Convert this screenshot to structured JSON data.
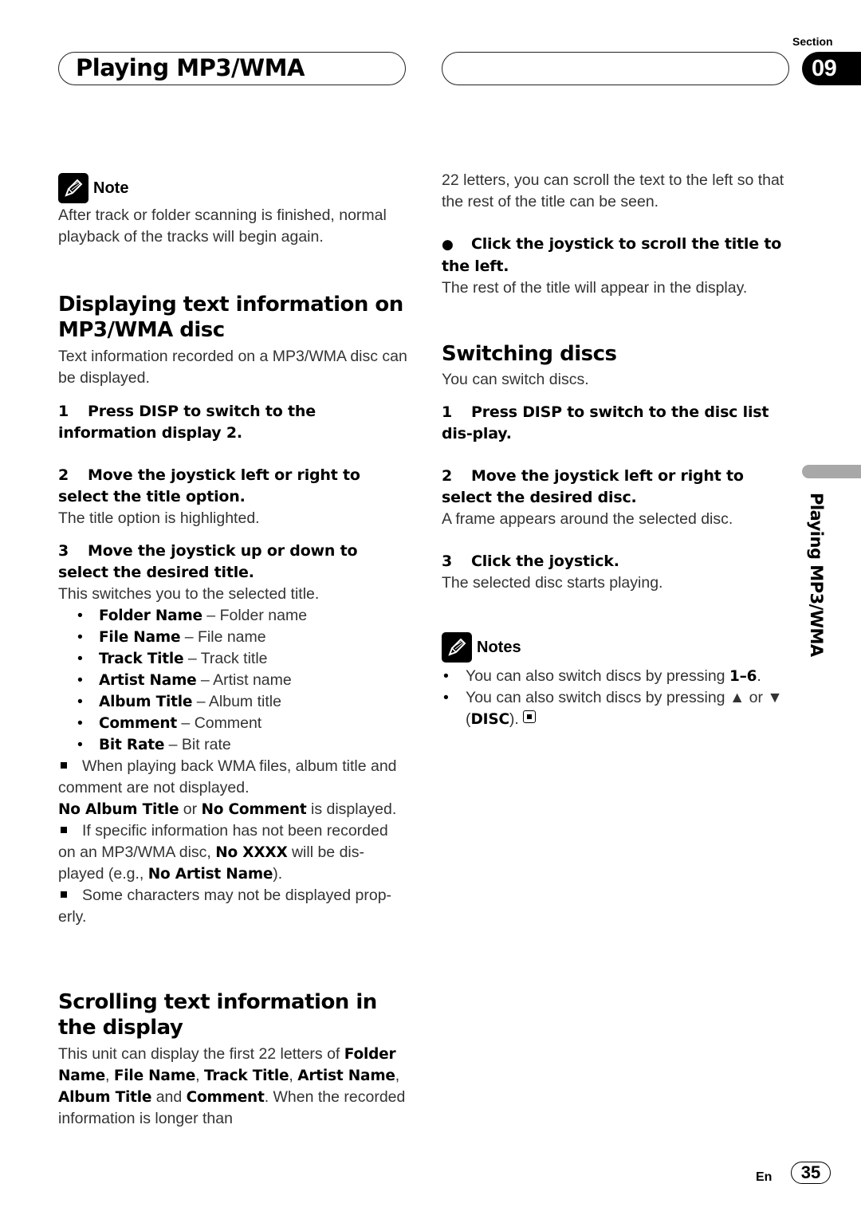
{
  "header": {
    "title": "Playing MP3/WMA",
    "section_label": "Section",
    "section_number": "09"
  },
  "side_tab": {
    "label": "Playing MP3/WMA"
  },
  "left": {
    "note": {
      "title": "Note",
      "icon": "pencil-icon",
      "text": "After track or folder scanning is finished, normal playback of the tracks will begin again."
    },
    "displaying": {
      "heading": "Displaying text information on MP3/WMA disc",
      "intro": "Text information recorded on a MP3/WMA disc can be displayed.",
      "steps": [
        {
          "num": "1",
          "text": "Press DISP to switch to the information display 2.",
          "desc": ""
        },
        {
          "num": "2",
          "text": "Move the joystick left or right to select the title option.",
          "desc": "The title option is highlighted."
        },
        {
          "num": "3",
          "text": "Move the joystick up or down to select the desired title.",
          "desc": "This switches you to the selected title."
        }
      ],
      "options": [
        {
          "bold": "Folder Name",
          "desc": " – Folder name"
        },
        {
          "bold": "File Name",
          "desc": " – File name"
        },
        {
          "bold": "Track Title",
          "desc": " – Track title"
        },
        {
          "bold": "Artist Name",
          "desc": " – Artist name"
        },
        {
          "bold": "Album Title",
          "desc": " – Album title"
        },
        {
          "bold": "Comment",
          "desc": " – Comment"
        },
        {
          "bold": "Bit Rate",
          "desc": " – Bit rate"
        }
      ],
      "remarks": {
        "r1": "When playing back WMA files, album title and comment are not displayed.",
        "r1b_bold1": "No Album Title",
        "r1b_mid": " or ",
        "r1b_bold2": "No Comment",
        "r1b_end": " is displayed.",
        "r2_start": "If specific information has not been recorded on an MP3/WMA disc, ",
        "r2_bold1": "No XXXX",
        "r2_mid": " will be dis-played (e.g., ",
        "r2_bold2": "No Artist Name",
        "r2_end": ").",
        "r3": "Some characters may not be displayed prop-erly."
      }
    },
    "scrolling": {
      "heading": "Scrolling text information in the display",
      "p_start": "This unit can display the first 22 letters of ",
      "b1": "Folder Name",
      "s1": ", ",
      "b2": "File Name",
      "s2": ", ",
      "b3": "Track Title",
      "s3": ", ",
      "b4": "Artist Name",
      "s4": ", ",
      "b5": "Album Title",
      "s5": " and ",
      "b6": "Comment",
      "s6": ".",
      "p_end": "When the recorded information is longer than"
    }
  },
  "right": {
    "scroll_cont": "22 letters, you can scroll the text to the left so that the rest of the title can be seen.",
    "scroll_step": {
      "bullet": "●",
      "text": "Click the joystick to scroll the title to the left.",
      "desc": "The rest of the title will appear in the display."
    },
    "switching": {
      "heading": "Switching discs",
      "intro": "You can switch discs.",
      "steps": [
        {
          "num": "1",
          "text": "Press DISP to switch to the disc list dis-play.",
          "desc": ""
        },
        {
          "num": "2",
          "text": "Move the joystick left or right to select the desired disc.",
          "desc": "A frame appears around the selected disc."
        },
        {
          "num": "3",
          "text": "Click the joystick.",
          "desc": "The selected disc starts playing."
        }
      ]
    },
    "notes": {
      "title": "Notes",
      "icon": "pencil-icon",
      "n1_start": "You can also switch discs by pressing ",
      "n1_bold": "1–6",
      "n1_end": ".",
      "n2_start": "You can also switch discs by pressing ▲ or ▼ (",
      "n2_bold": "DISC",
      "n2_end": ")."
    }
  },
  "footer": {
    "lang": "En",
    "page": "35"
  }
}
